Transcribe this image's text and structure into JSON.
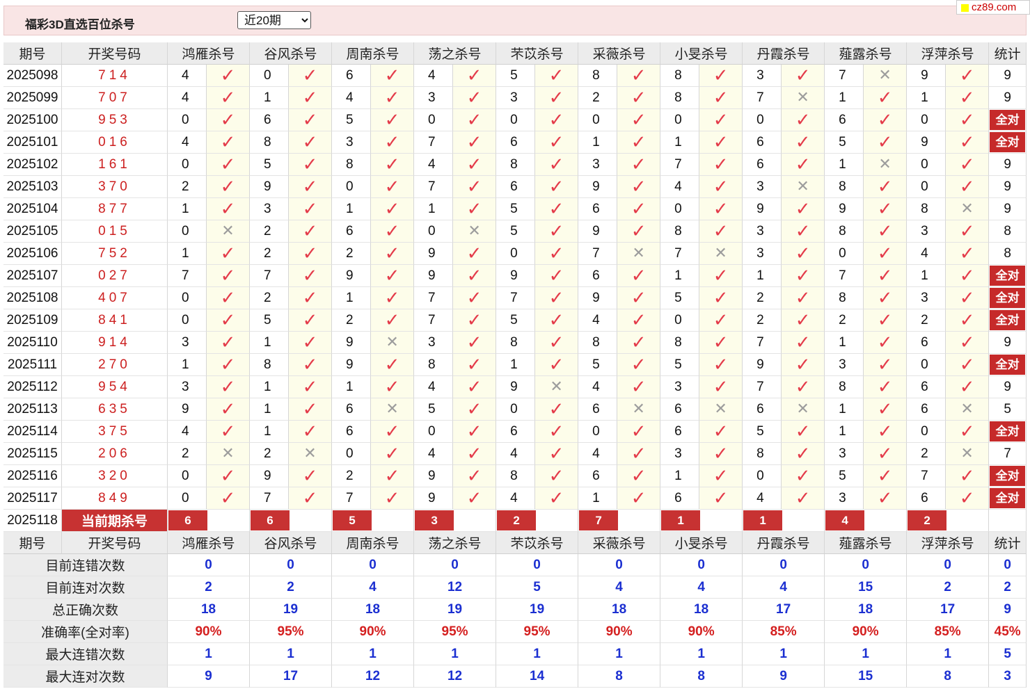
{
  "header": {
    "title": "福彩3D直选百位杀号",
    "period_select": {
      "selected": "近20期"
    }
  },
  "brand": "cz89.com",
  "columns": {
    "issue": "期号",
    "draw": "开奖号码",
    "experts": [
      "鸿雁杀号",
      "谷风杀号",
      "周南杀号",
      "荡之杀号",
      "芣苡杀号",
      "采薇杀号",
      "小旻杀号",
      "丹霞杀号",
      "薤露杀号",
      "浮萍杀号"
    ],
    "stat": "统计"
  },
  "marks": {
    "ok": "✓",
    "no": "✕"
  },
  "all_pass_label": "全对",
  "rows": [
    {
      "issue": "2025098",
      "draw": "714",
      "kills": [
        4,
        0,
        6,
        4,
        5,
        8,
        8,
        3,
        7,
        9
      ],
      "ok": [
        1,
        1,
        1,
        1,
        1,
        1,
        1,
        1,
        0,
        1
      ],
      "stat": "9"
    },
    {
      "issue": "2025099",
      "draw": "707",
      "kills": [
        4,
        1,
        4,
        3,
        3,
        2,
        8,
        7,
        1,
        1
      ],
      "ok": [
        1,
        1,
        1,
        1,
        1,
        1,
        1,
        0,
        1,
        1
      ],
      "stat": "9"
    },
    {
      "issue": "2025100",
      "draw": "953",
      "kills": [
        0,
        6,
        5,
        0,
        0,
        0,
        0,
        0,
        6,
        0
      ],
      "ok": [
        1,
        1,
        1,
        1,
        1,
        1,
        1,
        1,
        1,
        1
      ],
      "stat": "全对"
    },
    {
      "issue": "2025101",
      "draw": "016",
      "kills": [
        4,
        8,
        3,
        7,
        6,
        1,
        1,
        6,
        5,
        9
      ],
      "ok": [
        1,
        1,
        1,
        1,
        1,
        1,
        1,
        1,
        1,
        1
      ],
      "stat": "全对"
    },
    {
      "issue": "2025102",
      "draw": "161",
      "kills": [
        0,
        5,
        8,
        4,
        8,
        3,
        7,
        6,
        1,
        0
      ],
      "ok": [
        1,
        1,
        1,
        1,
        1,
        1,
        1,
        1,
        0,
        1
      ],
      "stat": "9"
    },
    {
      "issue": "2025103",
      "draw": "370",
      "kills": [
        2,
        9,
        0,
        7,
        6,
        9,
        4,
        3,
        8,
        0
      ],
      "ok": [
        1,
        1,
        1,
        1,
        1,
        1,
        1,
        0,
        1,
        1
      ],
      "stat": "9"
    },
    {
      "issue": "2025104",
      "draw": "877",
      "kills": [
        1,
        3,
        1,
        1,
        5,
        6,
        0,
        9,
        9,
        8
      ],
      "ok": [
        1,
        1,
        1,
        1,
        1,
        1,
        1,
        1,
        1,
        0
      ],
      "stat": "9"
    },
    {
      "issue": "2025105",
      "draw": "015",
      "kills": [
        0,
        2,
        6,
        0,
        5,
        9,
        8,
        3,
        8,
        3
      ],
      "ok": [
        0,
        1,
        1,
        0,
        1,
        1,
        1,
        1,
        1,
        1
      ],
      "stat": "8"
    },
    {
      "issue": "2025106",
      "draw": "752",
      "kills": [
        1,
        2,
        2,
        9,
        0,
        7,
        7,
        3,
        0,
        4
      ],
      "ok": [
        1,
        1,
        1,
        1,
        1,
        0,
        0,
        1,
        1,
        1
      ],
      "stat": "8"
    },
    {
      "issue": "2025107",
      "draw": "027",
      "kills": [
        7,
        7,
        9,
        9,
        9,
        6,
        1,
        1,
        7,
        1
      ],
      "ok": [
        1,
        1,
        1,
        1,
        1,
        1,
        1,
        1,
        1,
        1
      ],
      "stat": "全对"
    },
    {
      "issue": "2025108",
      "draw": "407",
      "kills": [
        0,
        2,
        1,
        7,
        7,
        9,
        5,
        2,
        8,
        3
      ],
      "ok": [
        1,
        1,
        1,
        1,
        1,
        1,
        1,
        1,
        1,
        1
      ],
      "stat": "全对"
    },
    {
      "issue": "2025109",
      "draw": "841",
      "kills": [
        0,
        5,
        2,
        7,
        5,
        4,
        0,
        2,
        2,
        2
      ],
      "ok": [
        1,
        1,
        1,
        1,
        1,
        1,
        1,
        1,
        1,
        1
      ],
      "stat": "全对"
    },
    {
      "issue": "2025110",
      "draw": "914",
      "kills": [
        3,
        1,
        9,
        3,
        8,
        8,
        8,
        7,
        1,
        6
      ],
      "ok": [
        1,
        1,
        0,
        1,
        1,
        1,
        1,
        1,
        1,
        1
      ],
      "stat": "9"
    },
    {
      "issue": "2025111",
      "draw": "270",
      "kills": [
        1,
        8,
        9,
        8,
        1,
        5,
        5,
        9,
        3,
        0
      ],
      "ok": [
        1,
        1,
        1,
        1,
        1,
        1,
        1,
        1,
        1,
        1
      ],
      "stat": "全对"
    },
    {
      "issue": "2025112",
      "draw": "954",
      "kills": [
        3,
        1,
        1,
        4,
        9,
        4,
        3,
        7,
        8,
        6
      ],
      "ok": [
        1,
        1,
        1,
        1,
        0,
        1,
        1,
        1,
        1,
        1
      ],
      "stat": "9"
    },
    {
      "issue": "2025113",
      "draw": "635",
      "kills": [
        9,
        1,
        6,
        5,
        0,
        6,
        6,
        6,
        1,
        6
      ],
      "ok": [
        1,
        1,
        0,
        1,
        1,
        0,
        0,
        0,
        1,
        0
      ],
      "stat": "5"
    },
    {
      "issue": "2025114",
      "draw": "375",
      "kills": [
        4,
        1,
        6,
        0,
        6,
        0,
        6,
        5,
        1,
        0
      ],
      "ok": [
        1,
        1,
        1,
        1,
        1,
        1,
        1,
        1,
        1,
        1
      ],
      "stat": "全对"
    },
    {
      "issue": "2025115",
      "draw": "206",
      "kills": [
        2,
        2,
        0,
        4,
        4,
        4,
        3,
        8,
        3,
        2
      ],
      "ok": [
        0,
        0,
        1,
        1,
        1,
        1,
        1,
        1,
        1,
        0
      ],
      "stat": "7"
    },
    {
      "issue": "2025116",
      "draw": "320",
      "kills": [
        0,
        9,
        2,
        9,
        8,
        6,
        1,
        0,
        5,
        7
      ],
      "ok": [
        1,
        1,
        1,
        1,
        1,
        1,
        1,
        1,
        1,
        1
      ],
      "stat": "全对"
    },
    {
      "issue": "2025117",
      "draw": "849",
      "kills": [
        0,
        7,
        7,
        9,
        4,
        1,
        6,
        4,
        3,
        6
      ],
      "ok": [
        1,
        1,
        1,
        1,
        1,
        1,
        1,
        1,
        1,
        1
      ],
      "stat": "全对"
    }
  ],
  "current": {
    "issue": "2025118",
    "label": "当前期杀号",
    "kills": [
      "6",
      "6",
      "5",
      "3",
      "2",
      "7",
      "1",
      "1",
      "4",
      "2"
    ]
  },
  "stats": [
    {
      "label": "目前连错次数",
      "values": [
        "0",
        "0",
        "0",
        "0",
        "0",
        "0",
        "0",
        "0",
        "0",
        "0"
      ],
      "total": "0",
      "style": "val"
    },
    {
      "label": "目前连对次数",
      "values": [
        "2",
        "2",
        "4",
        "12",
        "5",
        "4",
        "4",
        "4",
        "15",
        "2"
      ],
      "total": "2",
      "style": "val"
    },
    {
      "label": "总正确次数",
      "values": [
        "18",
        "19",
        "18",
        "19",
        "19",
        "18",
        "18",
        "17",
        "18",
        "17"
      ],
      "total": "9",
      "style": "val"
    },
    {
      "label": "准确率(全对率)",
      "values": [
        "90%",
        "95%",
        "90%",
        "95%",
        "95%",
        "90%",
        "90%",
        "85%",
        "90%",
        "85%"
      ],
      "total": "45%",
      "style": "pct"
    },
    {
      "label": "最大连错次数",
      "values": [
        "1",
        "1",
        "1",
        "1",
        "1",
        "1",
        "1",
        "1",
        "1",
        "1"
      ],
      "total": "5",
      "style": "val"
    },
    {
      "label": "最大连对次数",
      "values": [
        "9",
        "17",
        "12",
        "12",
        "14",
        "8",
        "8",
        "9",
        "15",
        "8"
      ],
      "total": "3",
      "style": "val"
    }
  ]
}
